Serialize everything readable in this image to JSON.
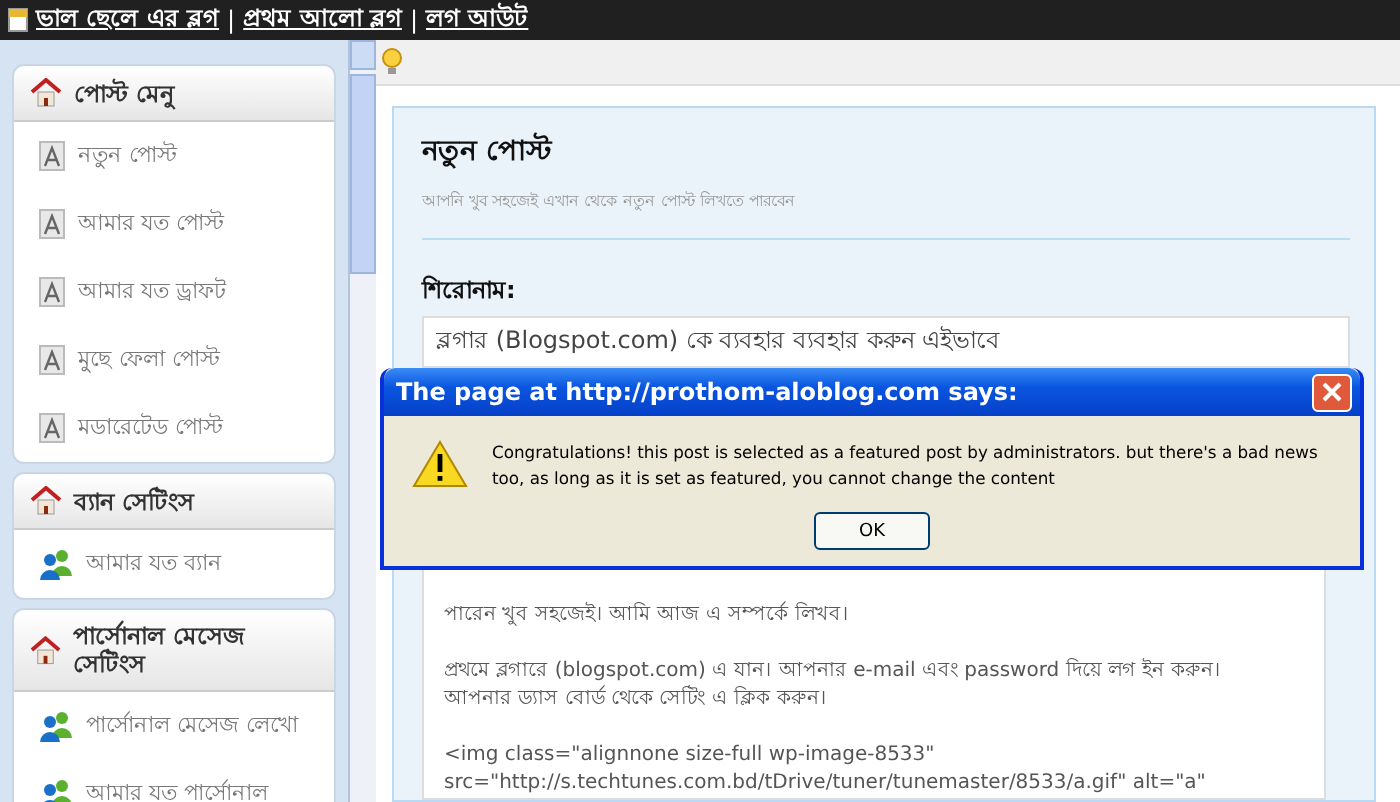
{
  "top_links": [
    {
      "label": "ভাল ছেলে এর ব্লগ"
    },
    {
      "label": "প্রথম আলো ব্লগ"
    },
    {
      "label": "লগ আউট"
    }
  ],
  "top_separator": "|",
  "sidebar": [
    {
      "title": "পোস্ট মেনু",
      "items": [
        {
          "label": "নতুন পোস্ট",
          "kind": "doc"
        },
        {
          "label": "আমার যত পোস্ট",
          "kind": "doc"
        },
        {
          "label": "আমার যত ড্রাফট",
          "kind": "doc"
        },
        {
          "label": "মুছে ফেলা পোস্ট",
          "kind": "doc"
        },
        {
          "label": "মডারেটেড পোস্ট",
          "kind": "doc"
        }
      ]
    },
    {
      "title": "ব্যান সেটিংস",
      "items": [
        {
          "label": "আমার যত ব্যান",
          "kind": "users"
        }
      ]
    },
    {
      "title": "পার্সোনাল মেসেজ সেটিংস",
      "items": [
        {
          "label": "পার্সোনাল মেসেজ লেখো",
          "kind": "users"
        },
        {
          "label": "আমার যত পার্সোনাল",
          "kind": "users"
        }
      ]
    }
  ],
  "form": {
    "title": "নতুন পোস্ট",
    "subtitle": "আপনি খুব সহজেই এখান থেকে নতুন পোস্ট লিখতে পারবেন",
    "title_label": "শিরোনাম:",
    "title_value": "ব্লগার (Blogspot.com) কে ব্যবহার ব্যবহার করুন এইভাবে",
    "body_paragraphs": [
      [
        "পারেন খুব সহজেই। আমি আজ এ সম্পর্কে লিখব।"
      ],
      [
        "প্রথমে ব্লগারে (blogspot.com) এ যান। আপনার e-mail এবং password দিয়ে লগ ইন করুন।",
        "আপনার ড্যাস বোর্ড থেকে সেটিং এ ক্লিক করুন।"
      ],
      [
        "<img class=\"alignnone size-full wp-image-8533\"",
        "src=\"http://s.techtunes.com.bd/tDrive/tuner/tunemaster/8533/a.gif\" alt=\"a\""
      ]
    ]
  },
  "dialog": {
    "title": "The page at http://prothom-aloblog.com says:",
    "message": "Congratulations! this post is selected as a featured post by administrators. but there's a bad news too, as long as it is set as featured, you cannot change the content",
    "button": "OK"
  }
}
